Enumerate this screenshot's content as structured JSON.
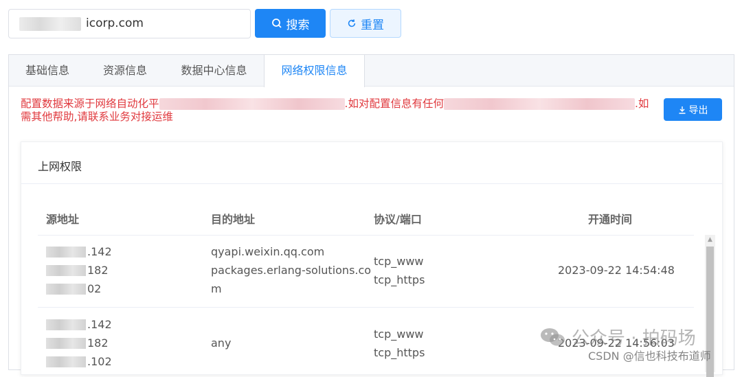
{
  "search": {
    "value_visible": "icorp.com"
  },
  "buttons": {
    "search": "搜索",
    "reset": "重置",
    "export": "导出"
  },
  "tabs": [
    {
      "label": "基础信息",
      "active": false
    },
    {
      "label": "资源信息",
      "active": false
    },
    {
      "label": "数据中心信息",
      "active": false
    },
    {
      "label": "网络权限信息",
      "active": true
    }
  ],
  "notice": {
    "part1": "配置数据来源于网络自动化平",
    "part2": ".如对配置信息有任何",
    "part3": ".如",
    "line2": "需其他帮助,请联系业务对接运维"
  },
  "card": {
    "title": "上网权限",
    "columns": [
      "源地址",
      "目的地址",
      "协议/端口",
      "开通时间"
    ],
    "rows": [
      {
        "src": [
          ".142",
          "182",
          "02"
        ],
        "dst": [
          "qyapi.weixin.qq.com",
          "packages.erlang-solutions.co",
          "m"
        ],
        "proto": [
          "tcp_www",
          "tcp_https"
        ],
        "time": "2023-09-22 14:54:48"
      },
      {
        "src": [
          ".142",
          "182",
          ".102"
        ],
        "dst": [
          "any"
        ],
        "proto": [
          "tcp_www",
          "tcp_https"
        ],
        "time": "2023-09-22 14:56:03"
      }
    ]
  },
  "watermark": {
    "text": "公众号 · 拍码场",
    "csdn": "CSDN @信也科技布道师"
  },
  "colors": {
    "primary": "#1e86f5",
    "warning_text": "#e0393e"
  },
  "icons": {
    "search": "search-icon",
    "reset": "refresh-icon",
    "export": "download-icon",
    "wechat": "wechat-icon"
  }
}
